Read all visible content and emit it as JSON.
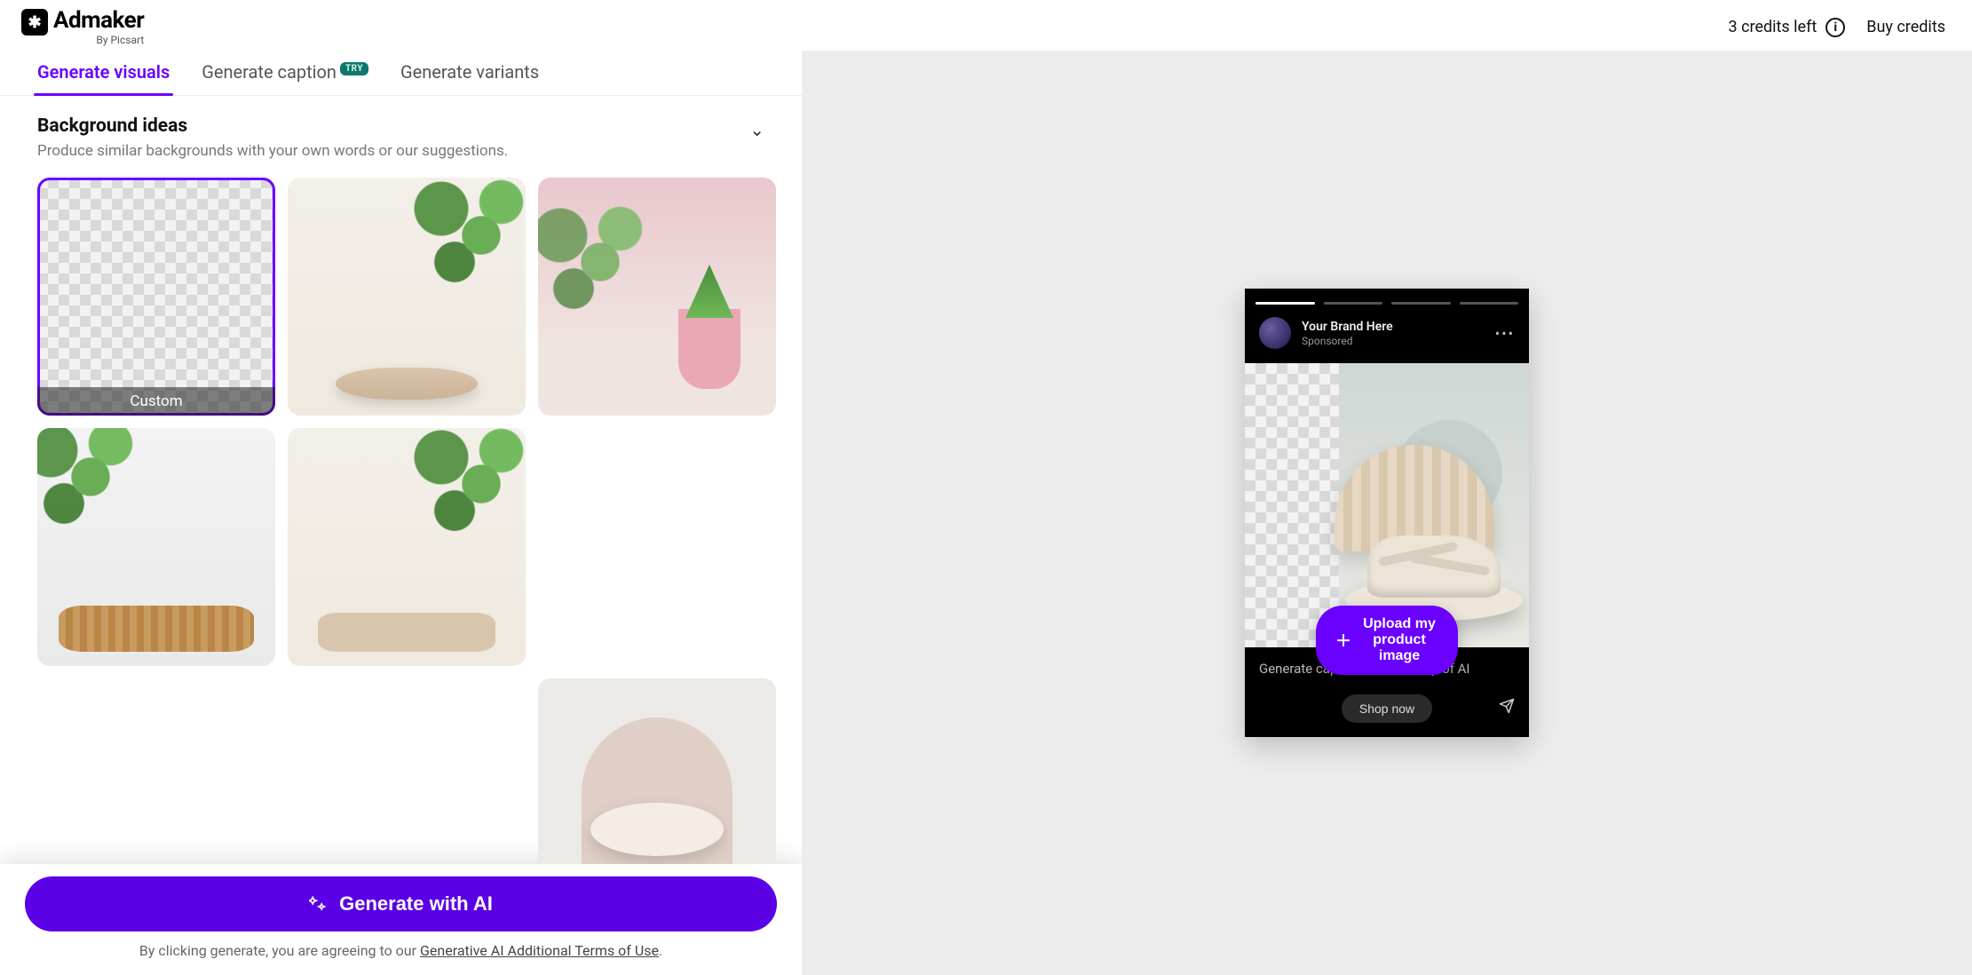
{
  "header": {
    "brand_title": "Admaker",
    "brand_sub": "By Picsart",
    "credits_left": "3 credits left",
    "info_char": "i",
    "buy_credits": "Buy credits"
  },
  "tabs": {
    "visuals": "Generate visuals",
    "caption": "Generate caption",
    "caption_badge": "TRY",
    "variants": "Generate variants"
  },
  "section": {
    "title": "Background ideas",
    "desc": "Produce similar backgrounds with your own words or our suggestions."
  },
  "tiles": {
    "custom_label": "Custom"
  },
  "action": {
    "generate": "Generate with AI",
    "disclaimer_prefix": "By clicking generate, you are agreeing to our ",
    "disclaimer_link": "Generative AI Additional Terms of Use",
    "disclaimer_suffix": "."
  },
  "preview": {
    "brand_name": "Your Brand Here",
    "sponsored": "Sponsored",
    "caption_hint": "Generate caption with the help of AI",
    "shop_now": "Shop now",
    "upload": "Upload my product image"
  }
}
